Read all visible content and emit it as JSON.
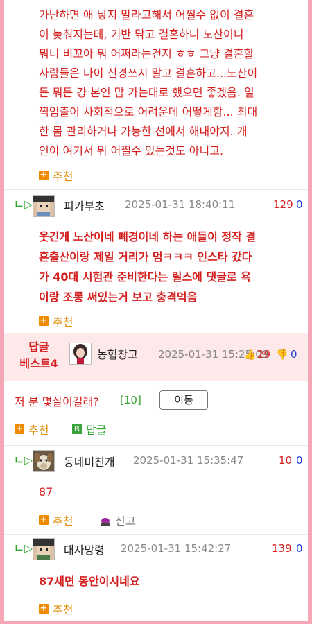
{
  "comment1": {
    "text": "가난하면 애 낳지 말라고해서 어쩔수 없이 결혼\n이 늦춰지는데, 기반 닦고 결혼하니 노산이니\n뭐니 비꼬아 뭐 어쩌라는건지 ㅎㅎ 그냥 결혼할\n사람들은 나이 신경쓰지 말고 결혼하고...노산이\n든 뭐든 걍 본인 맘 가는대로 했으면 좋겠음. 일\n찍임출이 사회적으로 어려운데 어떻게함... 최대\n한 몸 관리하거나 가능한 선에서 해내야지. 개\n인이 여기서 뭐 어쩔수 있는것도 아니고.",
    "recommend": "추천"
  },
  "comment2": {
    "author": "피카부초",
    "date": "2025-01-31 18:40:11",
    "up": "129",
    "down": "0",
    "text": "웃긴게 노산이네 폐경이네 하는 애들이 정작 결\n혼출산이랑 제일 거리가 멈ㅋㅋㅋ 인스타 갔다\n가 40대 시험관 준비한다는 릴스에 댓글로 욕\n이랑 조롱 써있는거 보고 충격먹음",
    "recommend": "추천"
  },
  "best": {
    "label": "답글\n베스트4",
    "author": "농협창고",
    "date": "2025-01-31 15:25:09",
    "up": "29",
    "down": "0",
    "text": "저 분 몇살이길래?",
    "reply_count": "[10]",
    "move": "이동",
    "recommend": "추천",
    "reply": "답글"
  },
  "comment3": {
    "author": "동네미친개",
    "date": "2025-01-31 15:35:47",
    "up": "10",
    "down": "0",
    "text": "87",
    "recommend": "추천",
    "report": "신고"
  },
  "comment4": {
    "author": "대자망령",
    "date": "2025-01-31 15:42:27",
    "up": "139",
    "down": "0",
    "text": "87세면 동안이시네요",
    "recommend": "추천"
  }
}
